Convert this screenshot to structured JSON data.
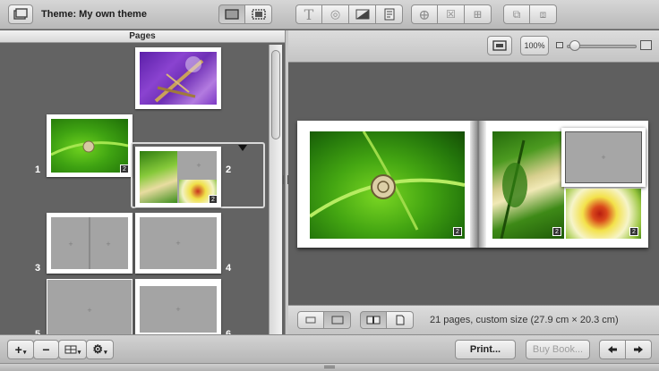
{
  "toolbar": {
    "theme_label": "Theme: My own theme",
    "icons": [
      "photo-browser-icon",
      "single-page-view-icon",
      "full-screen-view-icon",
      "text-box-icon",
      "shape-icon",
      "mask-icon",
      "page-layout-icon",
      "add-text-icon",
      "add-caption-icon",
      "add-map-icon",
      "add-page-icon",
      "remove-page-icon"
    ]
  },
  "pages_panel": {
    "header": "Pages",
    "page_numbers": [
      "1",
      "2",
      "3",
      "4",
      "5",
      "6"
    ]
  },
  "zoom": {
    "level": "100%",
    "slider_value": 0.05
  },
  "status": {
    "pages_info": "21 pages, custom size (27.9 cm × 20.3 cm)"
  },
  "bottom_bar": {
    "add_label": "+",
    "remove_label": "−",
    "print_label": "Print...",
    "buy_label": "Buy Book..."
  },
  "colors": {
    "accent_green": "#3f9a12",
    "selection_border": "#d9d9d9"
  }
}
